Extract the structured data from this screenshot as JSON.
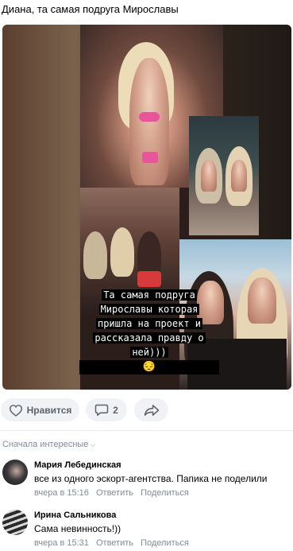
{
  "post": {
    "text": "Диана, та самая подруга Мирославы",
    "caption_lines": [
      "Та самая подруга",
      "Мирославы которая",
      "пришла на проект и",
      "рассказала правду о",
      "ней)))"
    ],
    "caption_emoji": "😔"
  },
  "actions": {
    "like_label": "Нравится",
    "like_icon": "heart-icon",
    "comment_count": "2",
    "comment_icon": "speech-bubble-icon",
    "share_icon": "share-arrow-icon"
  },
  "comments_header": {
    "sort_label": "Сначала интересные",
    "sort_icon": "chevron-down-icon"
  },
  "comments": [
    {
      "author": "Мария Лебединская",
      "text": "все из одного эскорт-агентства. Папика не поделили",
      "time": "вчера в 15:16",
      "reply": "Ответить",
      "share": "Поделиться"
    },
    {
      "author": "Ирина Сальникова",
      "text": "Сама невинность!))",
      "time": "вчера в 15:31",
      "reply": "Ответить",
      "share": "Поделиться"
    }
  ],
  "colors": {
    "accent_gray": "#818c99",
    "button_bg": "#f0f2f5",
    "button_text": "#5d646e"
  }
}
